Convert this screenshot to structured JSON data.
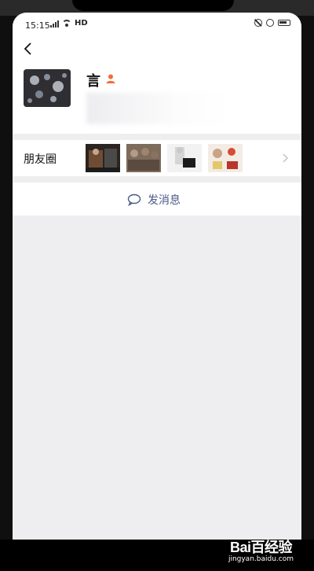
{
  "status_bar": {
    "time": "15:15",
    "network_label": "HD"
  },
  "profile": {
    "nickname": "言",
    "gender_icon": "user-icon",
    "accent_color": "#f26b3a"
  },
  "moments": {
    "label": "朋友圈",
    "thumbnails": [
      "moment-thumbnail-1",
      "moment-thumbnail-2",
      "moment-thumbnail-3",
      "moment-thumbnail-4"
    ]
  },
  "actions": {
    "send_message_label": "发消息",
    "send_message_color": "#4a5a86"
  },
  "watermark": {
    "brand": "Bai百经验",
    "url": "jingyan.baidu.com"
  }
}
